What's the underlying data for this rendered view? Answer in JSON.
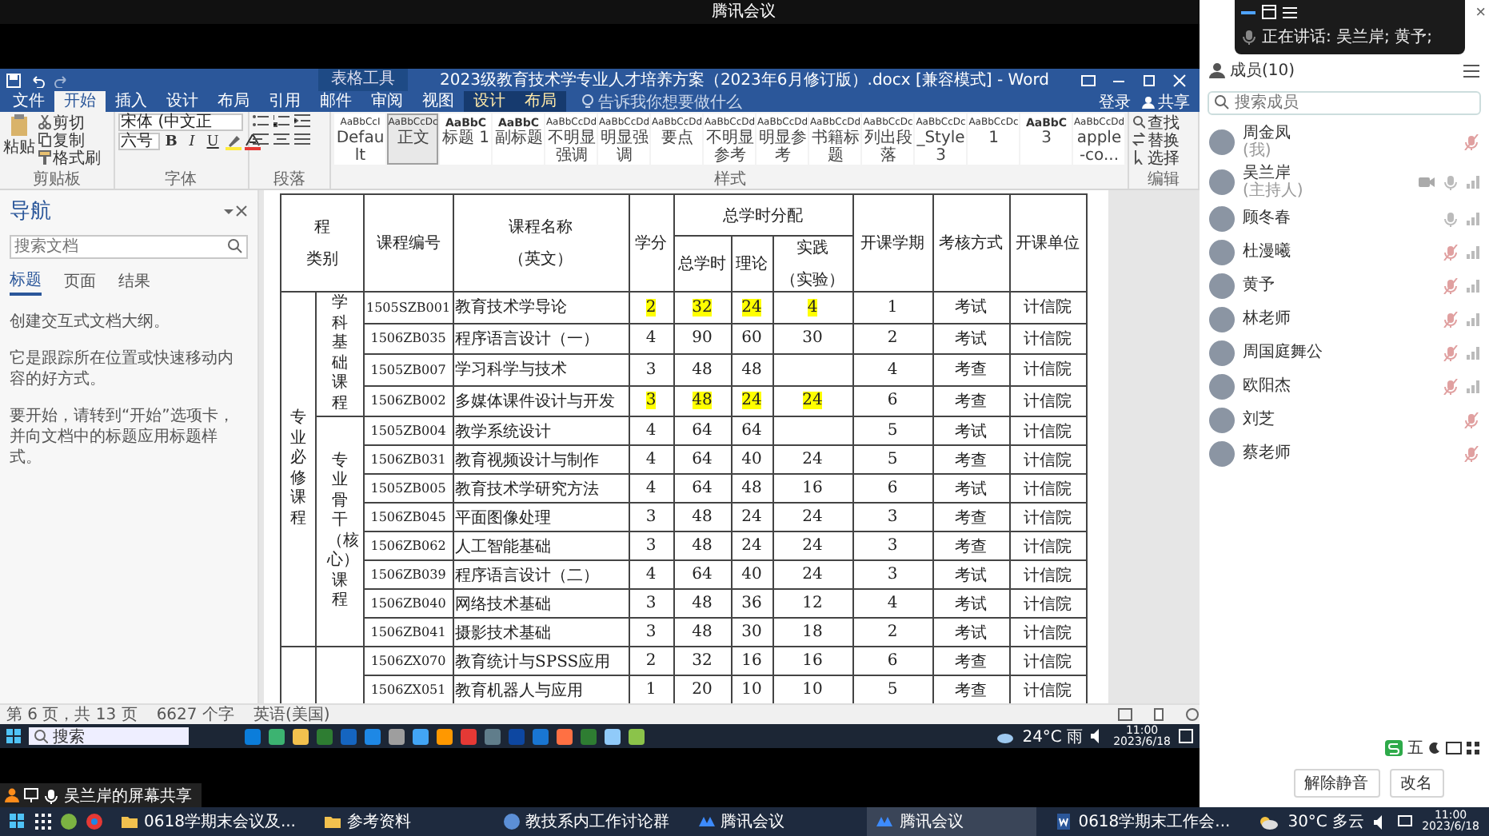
{
  "meeting": {
    "title": "腾讯会议"
  },
  "word": {
    "title": "2023级教育技术学专业人才培养方案（2023年6月修订版）.docx [兼容模式] - Word",
    "context_label": "表格工具",
    "menu_tabs": [
      {
        "label": "文件",
        "selected": false,
        "contextual": false
      },
      {
        "label": "开始",
        "selected": true,
        "contextual": false
      },
      {
        "label": "插入",
        "selected": false,
        "contextual": false
      },
      {
        "label": "设计",
        "selected": false,
        "contextual": false
      },
      {
        "label": "布局",
        "selected": false,
        "contextual": false
      },
      {
        "label": "引用",
        "selected": false,
        "contextual": false
      },
      {
        "label": "邮件",
        "selected": false,
        "contextual": false
      },
      {
        "label": "审阅",
        "selected": false,
        "contextual": false
      },
      {
        "label": "视图",
        "selected": false,
        "contextual": false
      },
      {
        "label": "设计",
        "selected": false,
        "contextual": true
      },
      {
        "label": "布局",
        "selected": false,
        "contextual": true
      }
    ],
    "tell_me": "告诉我你想要做什么",
    "sign_in": "登录",
    "share": "共享",
    "ribbon": {
      "paste": "粘贴",
      "cut": "剪切",
      "copy": "复制",
      "format_painter": "格式刷",
      "font_name": "宋体 (中文正",
      "font_size": "六号",
      "format_buttons": [
        "B",
        "I",
        "U"
      ],
      "styles": [
        {
          "preview": "AaBbCcI",
          "name": "Default",
          "kind": "plain",
          "selected": false
        },
        {
          "preview": "AaBbCcDc",
          "name": "正文",
          "kind": "plain",
          "selected": true
        },
        {
          "preview": "AaBbC",
          "name": "标题 1",
          "kind": "heading",
          "selected": false
        },
        {
          "preview": "AaBbC",
          "name": "副标题",
          "kind": "heading",
          "selected": false
        },
        {
          "preview": "AaBbCcDd",
          "name": "不明显强调",
          "kind": "plain",
          "selected": false
        },
        {
          "preview": "AaBbCcDd",
          "name": "明显强调",
          "kind": "plain",
          "selected": false
        },
        {
          "preview": "AaBbCcDd",
          "name": "要点",
          "kind": "plain",
          "selected": false
        },
        {
          "preview": "AaBbCcDd",
          "name": "不明显参考",
          "kind": "plain",
          "selected": false
        },
        {
          "preview": "AaBbCcDd",
          "name": "明显参考",
          "kind": "plain",
          "selected": false
        },
        {
          "preview": "AaBbCcDd",
          "name": "书籍标题",
          "kind": "plain",
          "selected": false
        },
        {
          "preview": "AaBbCcDc",
          "name": "列出段落",
          "kind": "plain",
          "selected": false
        },
        {
          "preview": "AaBbCcDc",
          "name": "_Style 3",
          "kind": "plain",
          "selected": false
        },
        {
          "preview": "AaBbCcDc",
          "name": "1",
          "kind": "plain",
          "selected": false
        },
        {
          "preview": "AaBbC",
          "name": "3",
          "kind": "heading",
          "selected": false
        },
        {
          "preview": "AaBbCcDd",
          "name": "apple-co...",
          "kind": "plain",
          "selected": false
        }
      ],
      "editing": [
        "查找",
        "替换",
        "选择"
      ],
      "groups": [
        "剪贴板",
        "字体",
        "段落",
        "样式",
        "编辑"
      ]
    },
    "navigation": {
      "title": "导航",
      "search_placeholder": "搜索文档",
      "tabs": [
        {
          "label": "标题",
          "selected": true
        },
        {
          "label": "页面",
          "selected": false
        },
        {
          "label": "结果",
          "selected": false
        }
      ],
      "paragraphs": [
        "创建交互式文档大纲。",
        "它是跟踪所在位置或快速移动内容的好方式。",
        "要开始，请转到“开始”选项卡，并向文档中的标题应用标题样式。"
      ]
    },
    "table": {
      "header": {
        "category": [
          "程",
          "类别"
        ],
        "code": "课程编号",
        "name": [
          "课程名称",
          "（英文）"
        ],
        "credit": "学分",
        "hours_group": "总学时分配",
        "total": "总学时",
        "theory": "理论",
        "practice": [
          "实践",
          "（实验）"
        ],
        "term": "开课学期",
        "exam": "考核方式",
        "unit": "开课单位"
      },
      "sections": [
        {
          "label": "专业必修课程",
          "groups": [
            {
              "label": "学科基础课程",
              "rows": [
                {
                  "cells": [
                    "1505SZB001",
                    "教育技术学导论",
                    "2",
                    "32",
                    "24",
                    "4",
                    "1",
                    "考试",
                    "计信院"
                  ],
                  "highlighted": true
                },
                {
                  "cells": [
                    "1506ZB035",
                    "程序语言设计（一）",
                    "4",
                    "90",
                    "60",
                    "30",
                    "2",
                    "考试",
                    "计信院"
                  ],
                  "highlighted": false
                },
                {
                  "cells": [
                    "1505ZB007",
                    "学习科学与技术",
                    "3",
                    "48",
                    "48",
                    null,
                    "4",
                    "考查",
                    "计信院"
                  ],
                  "highlighted": false
                },
                {
                  "cells": [
                    "1506ZB002",
                    "多媒体课件设计与开发",
                    "3",
                    "48",
                    "24",
                    "24",
                    "6",
                    "考查",
                    "计信院"
                  ],
                  "highlighted": true
                }
              ]
            },
            {
              "label": "专业骨干（核心）课程",
              "rows": [
                {
                  "cells": [
                    "1505ZB004",
                    "教学系统设计",
                    "4",
                    "64",
                    "64",
                    null,
                    "5",
                    "考试",
                    "计信院"
                  ],
                  "highlighted": false
                },
                {
                  "cells": [
                    "1506ZB031",
                    "教育视频设计与制作",
                    "4",
                    "64",
                    "40",
                    "24",
                    "5",
                    "考查",
                    "计信院"
                  ],
                  "highlighted": false
                },
                {
                  "cells": [
                    "1505ZB005",
                    "教育技术学研究方法",
                    "4",
                    "64",
                    "48",
                    "16",
                    "6",
                    "考试",
                    "计信院"
                  ],
                  "highlighted": false
                },
                {
                  "cells": [
                    "1506ZB045",
                    "平面图像处理",
                    "3",
                    "48",
                    "24",
                    "24",
                    "3",
                    "考查",
                    "计信院"
                  ],
                  "highlighted": false
                },
                {
                  "cells": [
                    "1506ZB062",
                    "人工智能基础",
                    "3",
                    "48",
                    "24",
                    "24",
                    "3",
                    "考查",
                    "计信院"
                  ],
                  "highlighted": false
                },
                {
                  "cells": [
                    "1506ZB039",
                    "程序语言设计（二）",
                    "4",
                    "64",
                    "40",
                    "24",
                    "3",
                    "考试",
                    "计信院"
                  ],
                  "highlighted": false
                },
                {
                  "cells": [
                    "1506ZB040",
                    "网络技术基础",
                    "3",
                    "48",
                    "36",
                    "12",
                    "4",
                    "考试",
                    "计信院"
                  ],
                  "highlighted": false
                },
                {
                  "cells": [
                    "1506ZB041",
                    "摄影技术基础",
                    "3",
                    "48",
                    "30",
                    "18",
                    "2",
                    "考试",
                    "计信院"
                  ],
                  "highlighted": false
                }
              ]
            }
          ]
        },
        {
          "groups": [
            {
              "rows": [
                {
                  "cells": [
                    "1506ZX070",
                    "教育统计与SPSS应用",
                    "2",
                    "32",
                    "16",
                    "16",
                    "6",
                    "考查",
                    "计信院"
                  ],
                  "highlighted": false
                },
                {
                  "cells": [
                    "1506ZX051",
                    "教育机器人与应用",
                    "1",
                    "20",
                    "10",
                    "10",
                    "5",
                    "考查",
                    "计信院"
                  ],
                  "highlighted": false
                }
              ]
            }
          ]
        }
      ]
    },
    "status_bar": [
      "第 6 页，共 13 页",
      "6627 个字",
      "英语(美国)"
    ]
  },
  "shared_taskbar": {
    "search": "搜索",
    "weather": "24°C 雨",
    "time": "11:00",
    "date": "2023/6/18"
  },
  "presenter_label": "吴兰岸的屏幕共享",
  "members": {
    "close": "×",
    "title": "成员(10)",
    "speaking": "正在讲话: 吴兰岸; 黄予;",
    "search_placeholder": "搜索成员",
    "list": [
      {
        "name": "周金凤",
        "role": "(我)",
        "muted": true,
        "signal": false,
        "sharing": false
      },
      {
        "name": "吴兰岸",
        "role": "(主持人)",
        "muted": false,
        "signal": true,
        "sharing": true
      },
      {
        "name": "顾冬春",
        "muted": false,
        "signal": true,
        "sharing": false
      },
      {
        "name": "杜漫曦",
        "muted": true,
        "signal": true,
        "sharing": false
      },
      {
        "name": "黄予",
        "muted": true,
        "signal": true,
        "sharing": false
      },
      {
        "name": "林老师",
        "muted": true,
        "signal": true,
        "sharing": false
      },
      {
        "name": "周国庭舞公",
        "muted": true,
        "signal": true,
        "sharing": false
      },
      {
        "name": "欧阳杰",
        "muted": true,
        "signal": true,
        "sharing": false
      },
      {
        "name": "刘芝",
        "muted": true,
        "signal": false,
        "sharing": false
      },
      {
        "name": "蔡老师",
        "muted": true,
        "signal": false,
        "sharing": false
      }
    ]
  },
  "ime": {
    "mode": "五"
  },
  "actions": [
    "解除静音",
    "改名"
  ],
  "taskbar": {
    "apps": [
      {
        "label": "0618学期末会议及...",
        "kind": "folder",
        "selected": false
      },
      {
        "label": "参考资料",
        "kind": "folder",
        "selected": false
      },
      {
        "label": "教技系内工作讨论群",
        "kind": "chat",
        "selected": false
      },
      {
        "label": "腾讯会议",
        "kind": "meeting",
        "selected": false
      },
      {
        "label": "腾讯会议",
        "kind": "meeting",
        "selected": true
      },
      {
        "label": "0618学期末工作会...",
        "kind": "word",
        "selected": false
      }
    ],
    "weather": "30°C 多云",
    "time": "11:00",
    "date": "2023/6/18"
  }
}
